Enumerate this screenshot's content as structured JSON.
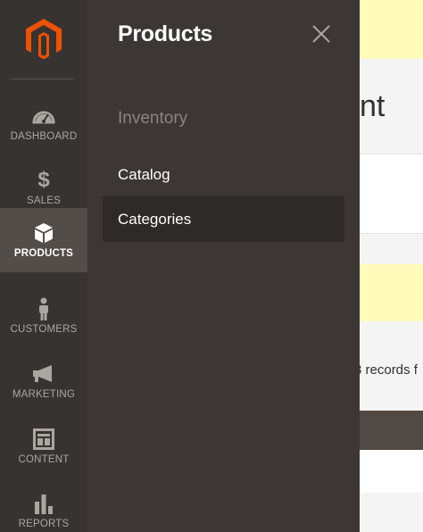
{
  "sidebar": {
    "logo_icon": "magento-logo",
    "accent_color": "#eb5202",
    "items": [
      {
        "label": "DASHBOARD",
        "icon": "speedometer-icon",
        "active": false
      },
      {
        "label": "SALES",
        "icon": "dollar-icon",
        "active": false
      },
      {
        "label": "PRODUCTS",
        "icon": "cube-icon",
        "active": true
      },
      {
        "label": "CUSTOMERS",
        "icon": "person-icon",
        "active": false
      },
      {
        "label": "MARKETING",
        "icon": "megaphone-icon",
        "active": false
      },
      {
        "label": "CONTENT",
        "icon": "layout-icon",
        "active": false
      },
      {
        "label": "REPORTS",
        "icon": "bar-chart-icon",
        "active": false
      }
    ]
  },
  "flyout": {
    "title": "Products",
    "close_icon": "close-icon",
    "section_title": "Inventory",
    "links": [
      {
        "label": "Catalog"
      },
      {
        "label": "Categories",
        "hovered": true
      }
    ]
  },
  "background": {
    "heading_fragment": "nt",
    "records_fragment": "3 records f"
  }
}
